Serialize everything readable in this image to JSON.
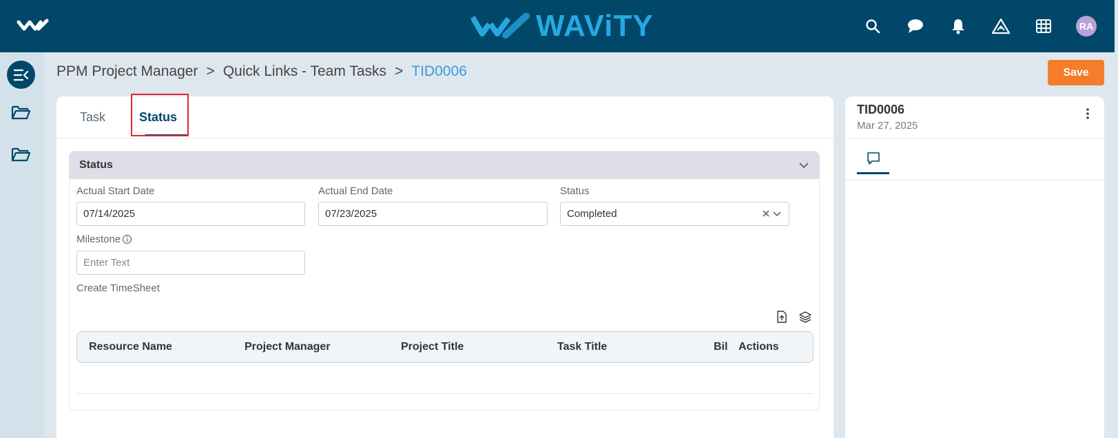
{
  "header": {
    "brand": "WAViTY",
    "avatar_initials": "RA",
    "icons": [
      "home-logo-icon",
      "search-icon",
      "chat-icon",
      "bell-icon",
      "warning-triangle-icon",
      "grid-icon"
    ]
  },
  "breadcrumb": {
    "items": [
      "PPM Project Manager",
      "Quick Links - Team Tasks",
      "TID0006"
    ],
    "separator": ">"
  },
  "toolbar": {
    "save_label": "Save"
  },
  "tabs": [
    {
      "label": "Task"
    },
    {
      "label": "Status",
      "active": true
    }
  ],
  "section": {
    "title": "Status",
    "fields": {
      "actual_start_date": {
        "label": "Actual Start Date",
        "value": "07/14/2025"
      },
      "actual_end_date": {
        "label": "Actual End Date",
        "value": "07/23/2025"
      },
      "status": {
        "label": "Status",
        "value": "Completed"
      },
      "milestone": {
        "label": "Milestone",
        "placeholder": "Enter Text"
      }
    },
    "timesheet": {
      "title": "Create TimeSheet",
      "columns": [
        "Resource Name",
        "Project Manager",
        "Project Title",
        "Task Title",
        "Bil",
        "Actions"
      ],
      "rows": []
    }
  },
  "side_panel": {
    "id": "TID0006",
    "date": "Mar 27, 2025"
  },
  "colors": {
    "header_bg": "#01476a",
    "brand_blue": "#27a8e0",
    "save_orange": "#f47c2a",
    "breadcrumb_current": "#3a9ad6",
    "section_header_bg": "#e0dde8",
    "focus_outline": "#e3242b"
  }
}
